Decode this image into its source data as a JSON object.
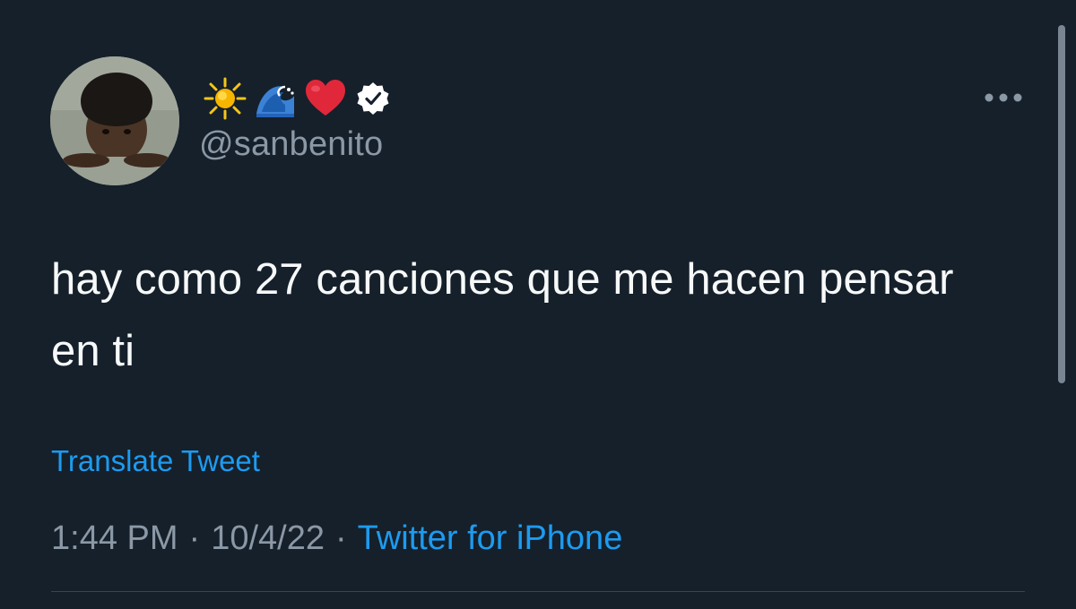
{
  "tweet": {
    "display_name_icons": [
      "sun-icon",
      "wave-icon",
      "red-heart-icon",
      "verified-badge-icon"
    ],
    "handle": "@sanbenito",
    "text": "hay como 27 canciones que me hacen pensar en ti",
    "translate_label": "Translate Tweet",
    "time": "1:44 PM",
    "separator": "·",
    "date": "10/4/22",
    "source": "Twitter for iPhone",
    "more_icon": "more-options-icon"
  },
  "colors": {
    "background": "#15202b",
    "primary_text": "#f7f9f9",
    "secondary_text": "#8b98a5",
    "link": "#1d9bf0",
    "divider": "#38444d",
    "heart": "#e0283a",
    "sun": "#f5c518"
  }
}
